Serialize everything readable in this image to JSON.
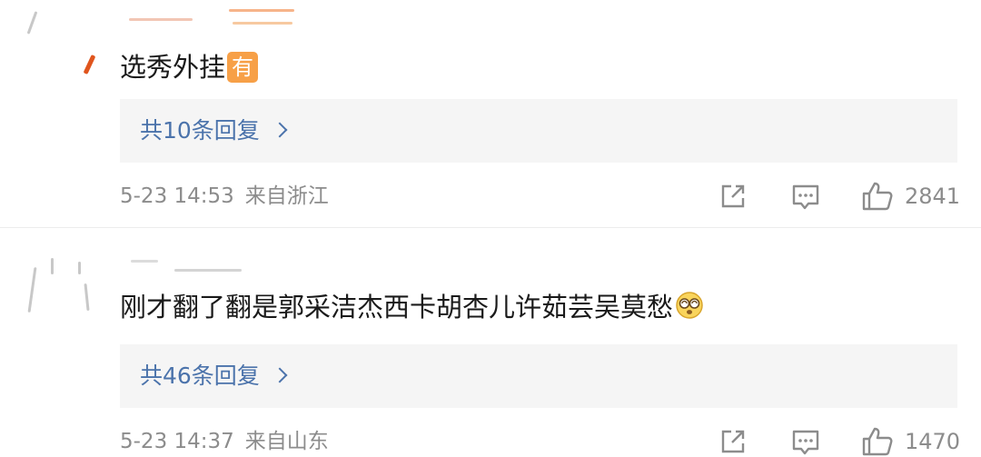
{
  "comments": [
    {
      "text": "选秀外挂",
      "badge": "有",
      "replies_label": "共10条回复",
      "date": "5-23 14:53",
      "location": "来自浙江",
      "likes": "2841"
    },
    {
      "text": "刚才翻了翻是郭采洁杰西卡胡杏儿许茹芸吴莫愁",
      "emoji": "dizzy-face-emoji",
      "replies_label": "共46条回复",
      "date": "5-23 14:37",
      "location": "来自山东",
      "likes": "1470"
    }
  ],
  "icons": {
    "share": "share-icon",
    "reply": "comment-icon",
    "like": "thumbs-up-icon"
  },
  "colors": {
    "link": "#4b73ab",
    "meta": "#8c8c8c",
    "badge": "#f7a047",
    "reply_box_bg": "#f5f5f5"
  }
}
